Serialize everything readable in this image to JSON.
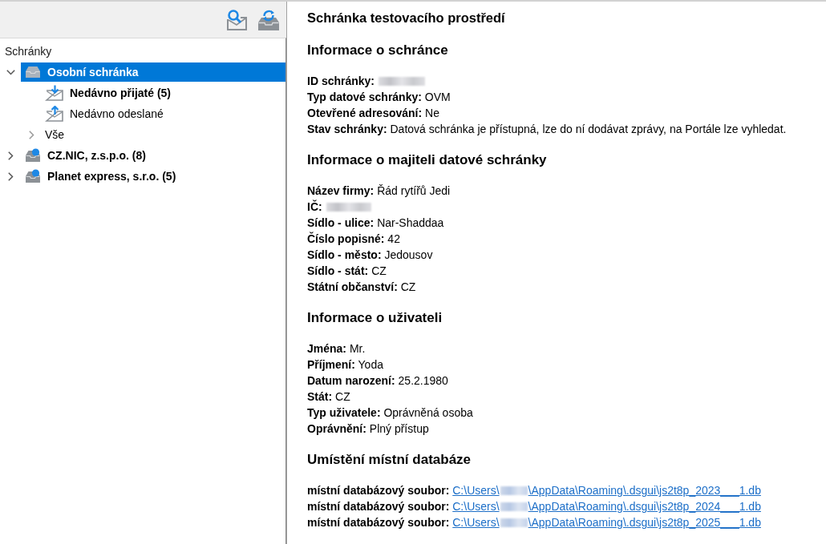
{
  "tree": {
    "header": "Schránky",
    "items": [
      {
        "label": "Osobní schránka",
        "kind": "testbox",
        "selected": true,
        "bold": true,
        "expanded": true,
        "children": [
          {
            "label": "Nedávno přijaté (5)",
            "kind": "received",
            "selected": false,
            "bold": true
          },
          {
            "label": "Nedávno odeslané",
            "kind": "sent",
            "selected": false,
            "bold": false
          },
          {
            "label": "Vše",
            "kind": "all",
            "selected": false,
            "bold": false,
            "expanded": false
          }
        ]
      },
      {
        "label": "CZ.NIC, z.s.p.o. (8)",
        "kind": "databox",
        "selected": false,
        "bold": true,
        "expanded": false
      },
      {
        "label": "Planet express, s.r.o. (5)",
        "kind": "databox",
        "selected": false,
        "bold": true,
        "expanded": false
      }
    ]
  },
  "detail": {
    "title": "Schránka testovacího prostředí",
    "sections": [
      {
        "heading": "Informace o schránce",
        "fields": [
          {
            "kind": "redacted",
            "label": "ID schránky:"
          },
          {
            "kind": "text",
            "label": "Typ datové schránky:",
            "value": "OVM"
          },
          {
            "kind": "text",
            "label": "Otevřené adresování:",
            "value": "Ne"
          },
          {
            "kind": "text",
            "label": "Stav schránky:",
            "value": "Datová schránka je přístupná, lze do ní dodávat zprávy, na Portále lze vyhledat."
          }
        ]
      },
      {
        "heading": "Informace o majiteli datové schránky",
        "fields": [
          {
            "kind": "text",
            "label": "Název firmy:",
            "value": "Řád rytířů Jedi"
          },
          {
            "kind": "redacted",
            "label": "IČ:"
          },
          {
            "kind": "text",
            "label": "Sídlo - ulice:",
            "value": "Nar-Shaddaa"
          },
          {
            "kind": "text",
            "label": "Číslo popisné:",
            "value": "42"
          },
          {
            "kind": "text",
            "label": "Sídlo - město:",
            "value": "Jedousov"
          },
          {
            "kind": "text",
            "label": "Sídlo - stát:",
            "value": "CZ"
          },
          {
            "kind": "text",
            "label": "Státní občanství:",
            "value": "CZ"
          }
        ]
      },
      {
        "heading": "Informace o uživateli",
        "fields": [
          {
            "kind": "text",
            "label": "Jména:",
            "value": "Mr."
          },
          {
            "kind": "text",
            "label": "Příjmení:",
            "value": "Yoda"
          },
          {
            "kind": "text",
            "label": "Datum narození:",
            "value": "25.2.1980"
          },
          {
            "kind": "text",
            "label": "Stát:",
            "value": "CZ"
          },
          {
            "kind": "text",
            "label": "Typ uživatele:",
            "value": "Oprávněná osoba"
          },
          {
            "kind": "text",
            "label": "Oprávnění:",
            "value": "Plný přístup"
          }
        ]
      },
      {
        "heading": "Umístění místní databáze",
        "fields": [
          {
            "kind": "path",
            "label": "místní databázový soubor:",
            "value_start": "C:\\Users\\",
            "value_end": "\\AppData\\Roaming\\.dsgui\\js2t8p_2023___1.db"
          },
          {
            "kind": "path",
            "label": "místní databázový soubor:",
            "value_start": "C:\\Users\\",
            "value_end": "\\AppData\\Roaming\\.dsgui\\js2t8p_2024___1.db"
          },
          {
            "kind": "path",
            "label": "místní databázový soubor:",
            "value_start": "C:\\Users\\",
            "value_end": "\\AppData\\Roaming\\.dsgui\\js2t8p_2025___1.db"
          }
        ]
      }
    ]
  }
}
